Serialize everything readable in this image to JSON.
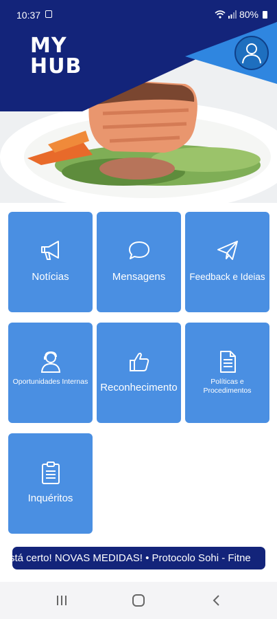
{
  "status": {
    "time": "10:37",
    "battery": "80%"
  },
  "app": {
    "logo_line1": "MY",
    "logo_line2": "HUB"
  },
  "colors": {
    "brand_dark": "#13247a",
    "accent_blue": "#2f86e0",
    "tile_blue": "#4a8fe2"
  },
  "tiles": [
    {
      "label": "Notícias",
      "icon": "megaphone-icon"
    },
    {
      "label": "Mensagens",
      "icon": "speech-bubble-icon"
    },
    {
      "label": "Feedback e Ideias",
      "icon": "paper-plane-icon"
    },
    {
      "label": "Oportunidades Internas",
      "icon": "person-icon"
    },
    {
      "label": "Reconhecimento",
      "icon": "thumbs-up-icon"
    },
    {
      "label": "Políticas e Procedimentos",
      "icon": "document-icon"
    },
    {
      "label": "Inquéritos",
      "icon": "clipboard-icon"
    }
  ],
  "ticker": {
    "text": "stá certo! NOVAS MEDIDAS!  •  Protocolo Sohi - Fitne"
  },
  "navbar": {
    "recent": "recent-apps-icon",
    "home": "home-icon",
    "back": "back-icon"
  }
}
